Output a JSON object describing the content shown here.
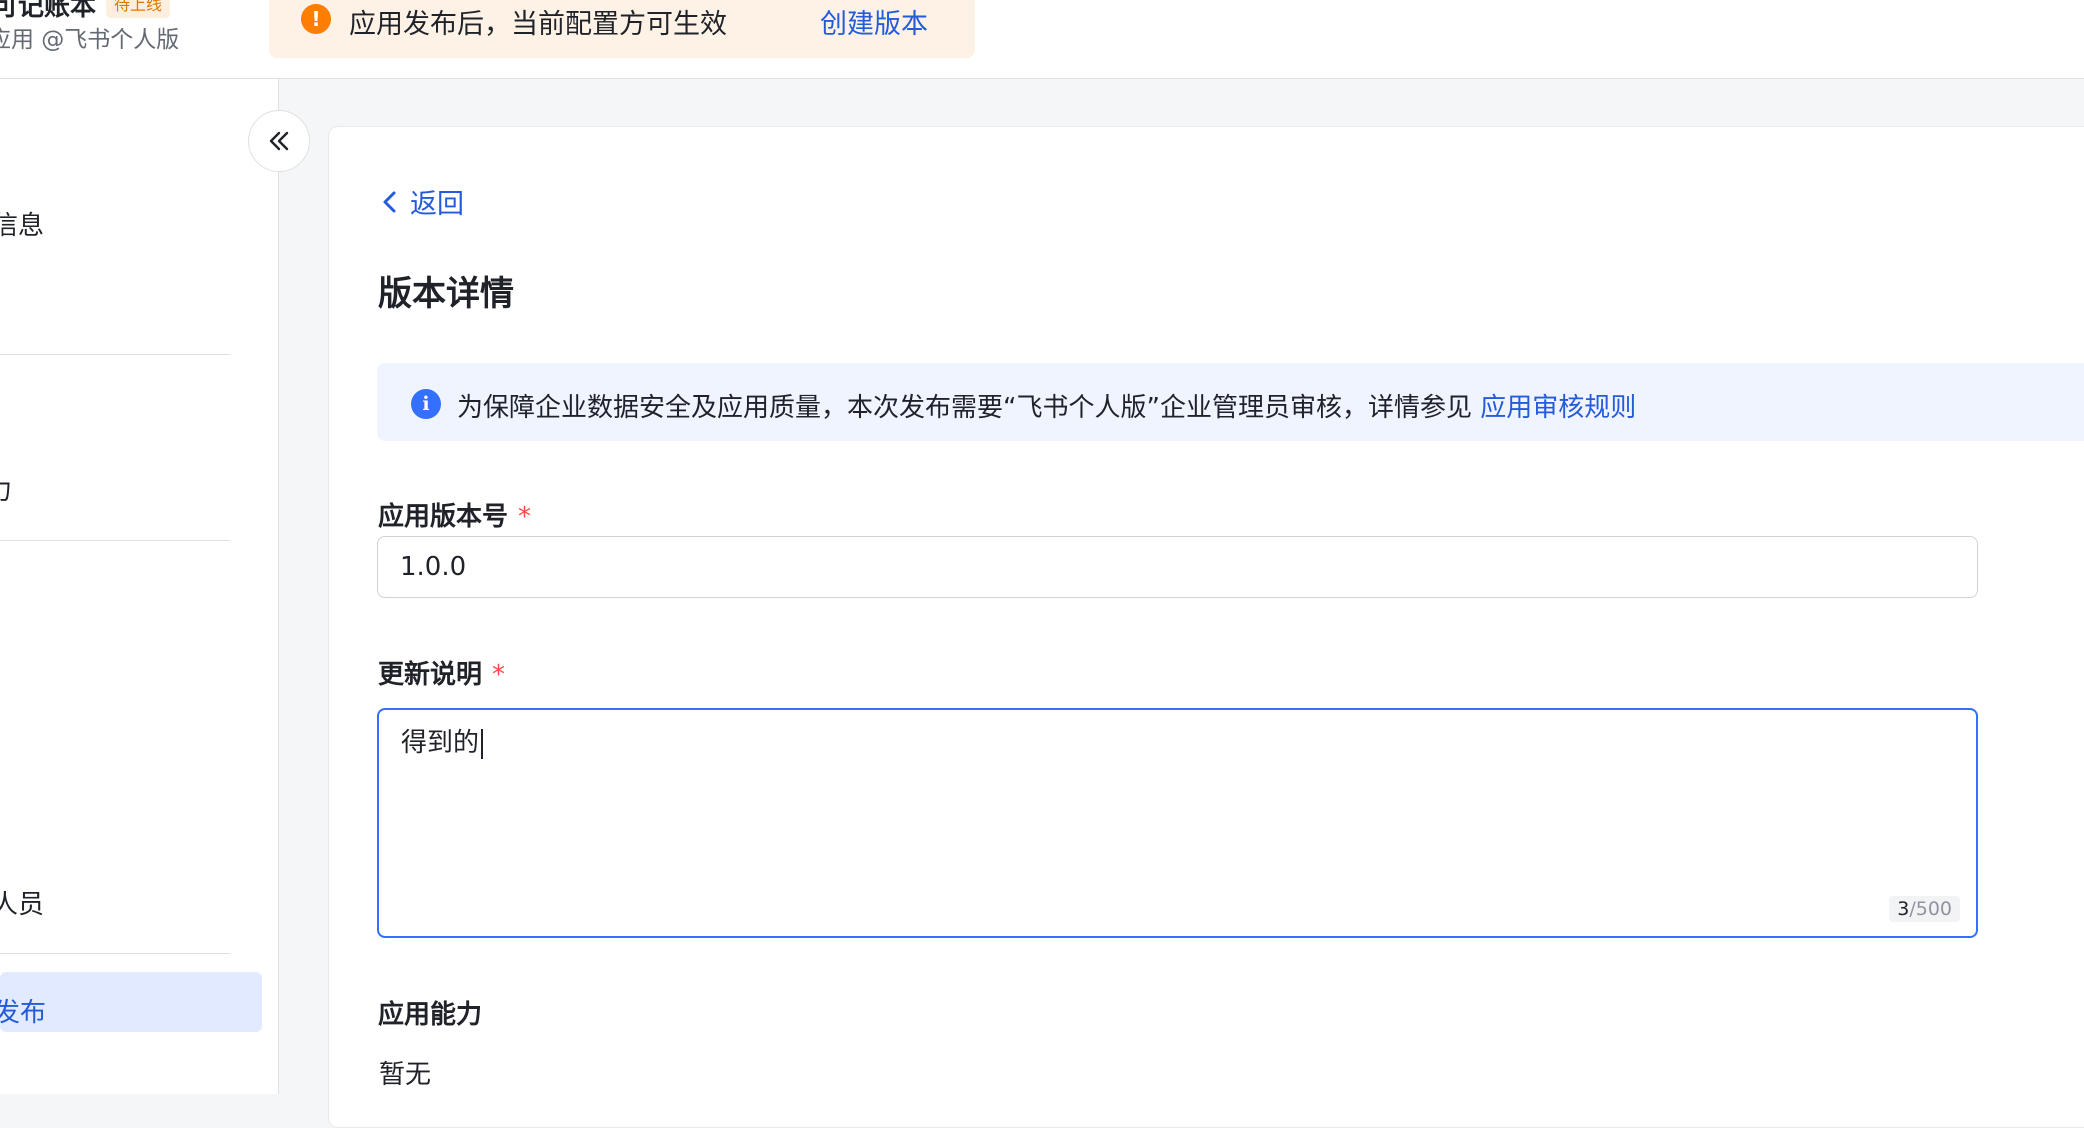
{
  "header": {
    "app_title": "可记账本",
    "app_badge": "待上线",
    "app_subtitle": "应用 @飞书个人版",
    "banner": {
      "text": "应用发布后，当前配置方可生效",
      "link": "创建版本"
    }
  },
  "sidebar": {
    "items": [
      {
        "label": "信息"
      },
      {
        "label": "力"
      },
      {
        "label": "人员"
      },
      {
        "label": "发布"
      }
    ]
  },
  "main": {
    "back_label": "返回",
    "title": "版本详情",
    "info": {
      "text": "为保障企业数据安全及应用质量，本次发布需要“飞书个人版”企业管理员审核，详情参见",
      "link": "应用审核规则"
    },
    "version_field": {
      "label": "应用版本号",
      "required_mark": "*",
      "value": "1.0.0"
    },
    "notes_field": {
      "label": "更新说明",
      "required_mark": "*",
      "value": "得到的",
      "count_current": "3",
      "count_max": "/500"
    },
    "capability": {
      "label": "应用能力",
      "value": "暂无"
    }
  },
  "colors": {
    "accent": "#3370ff",
    "link": "#245bdb",
    "warning": "#ff7d00",
    "required": "#f54a45"
  }
}
